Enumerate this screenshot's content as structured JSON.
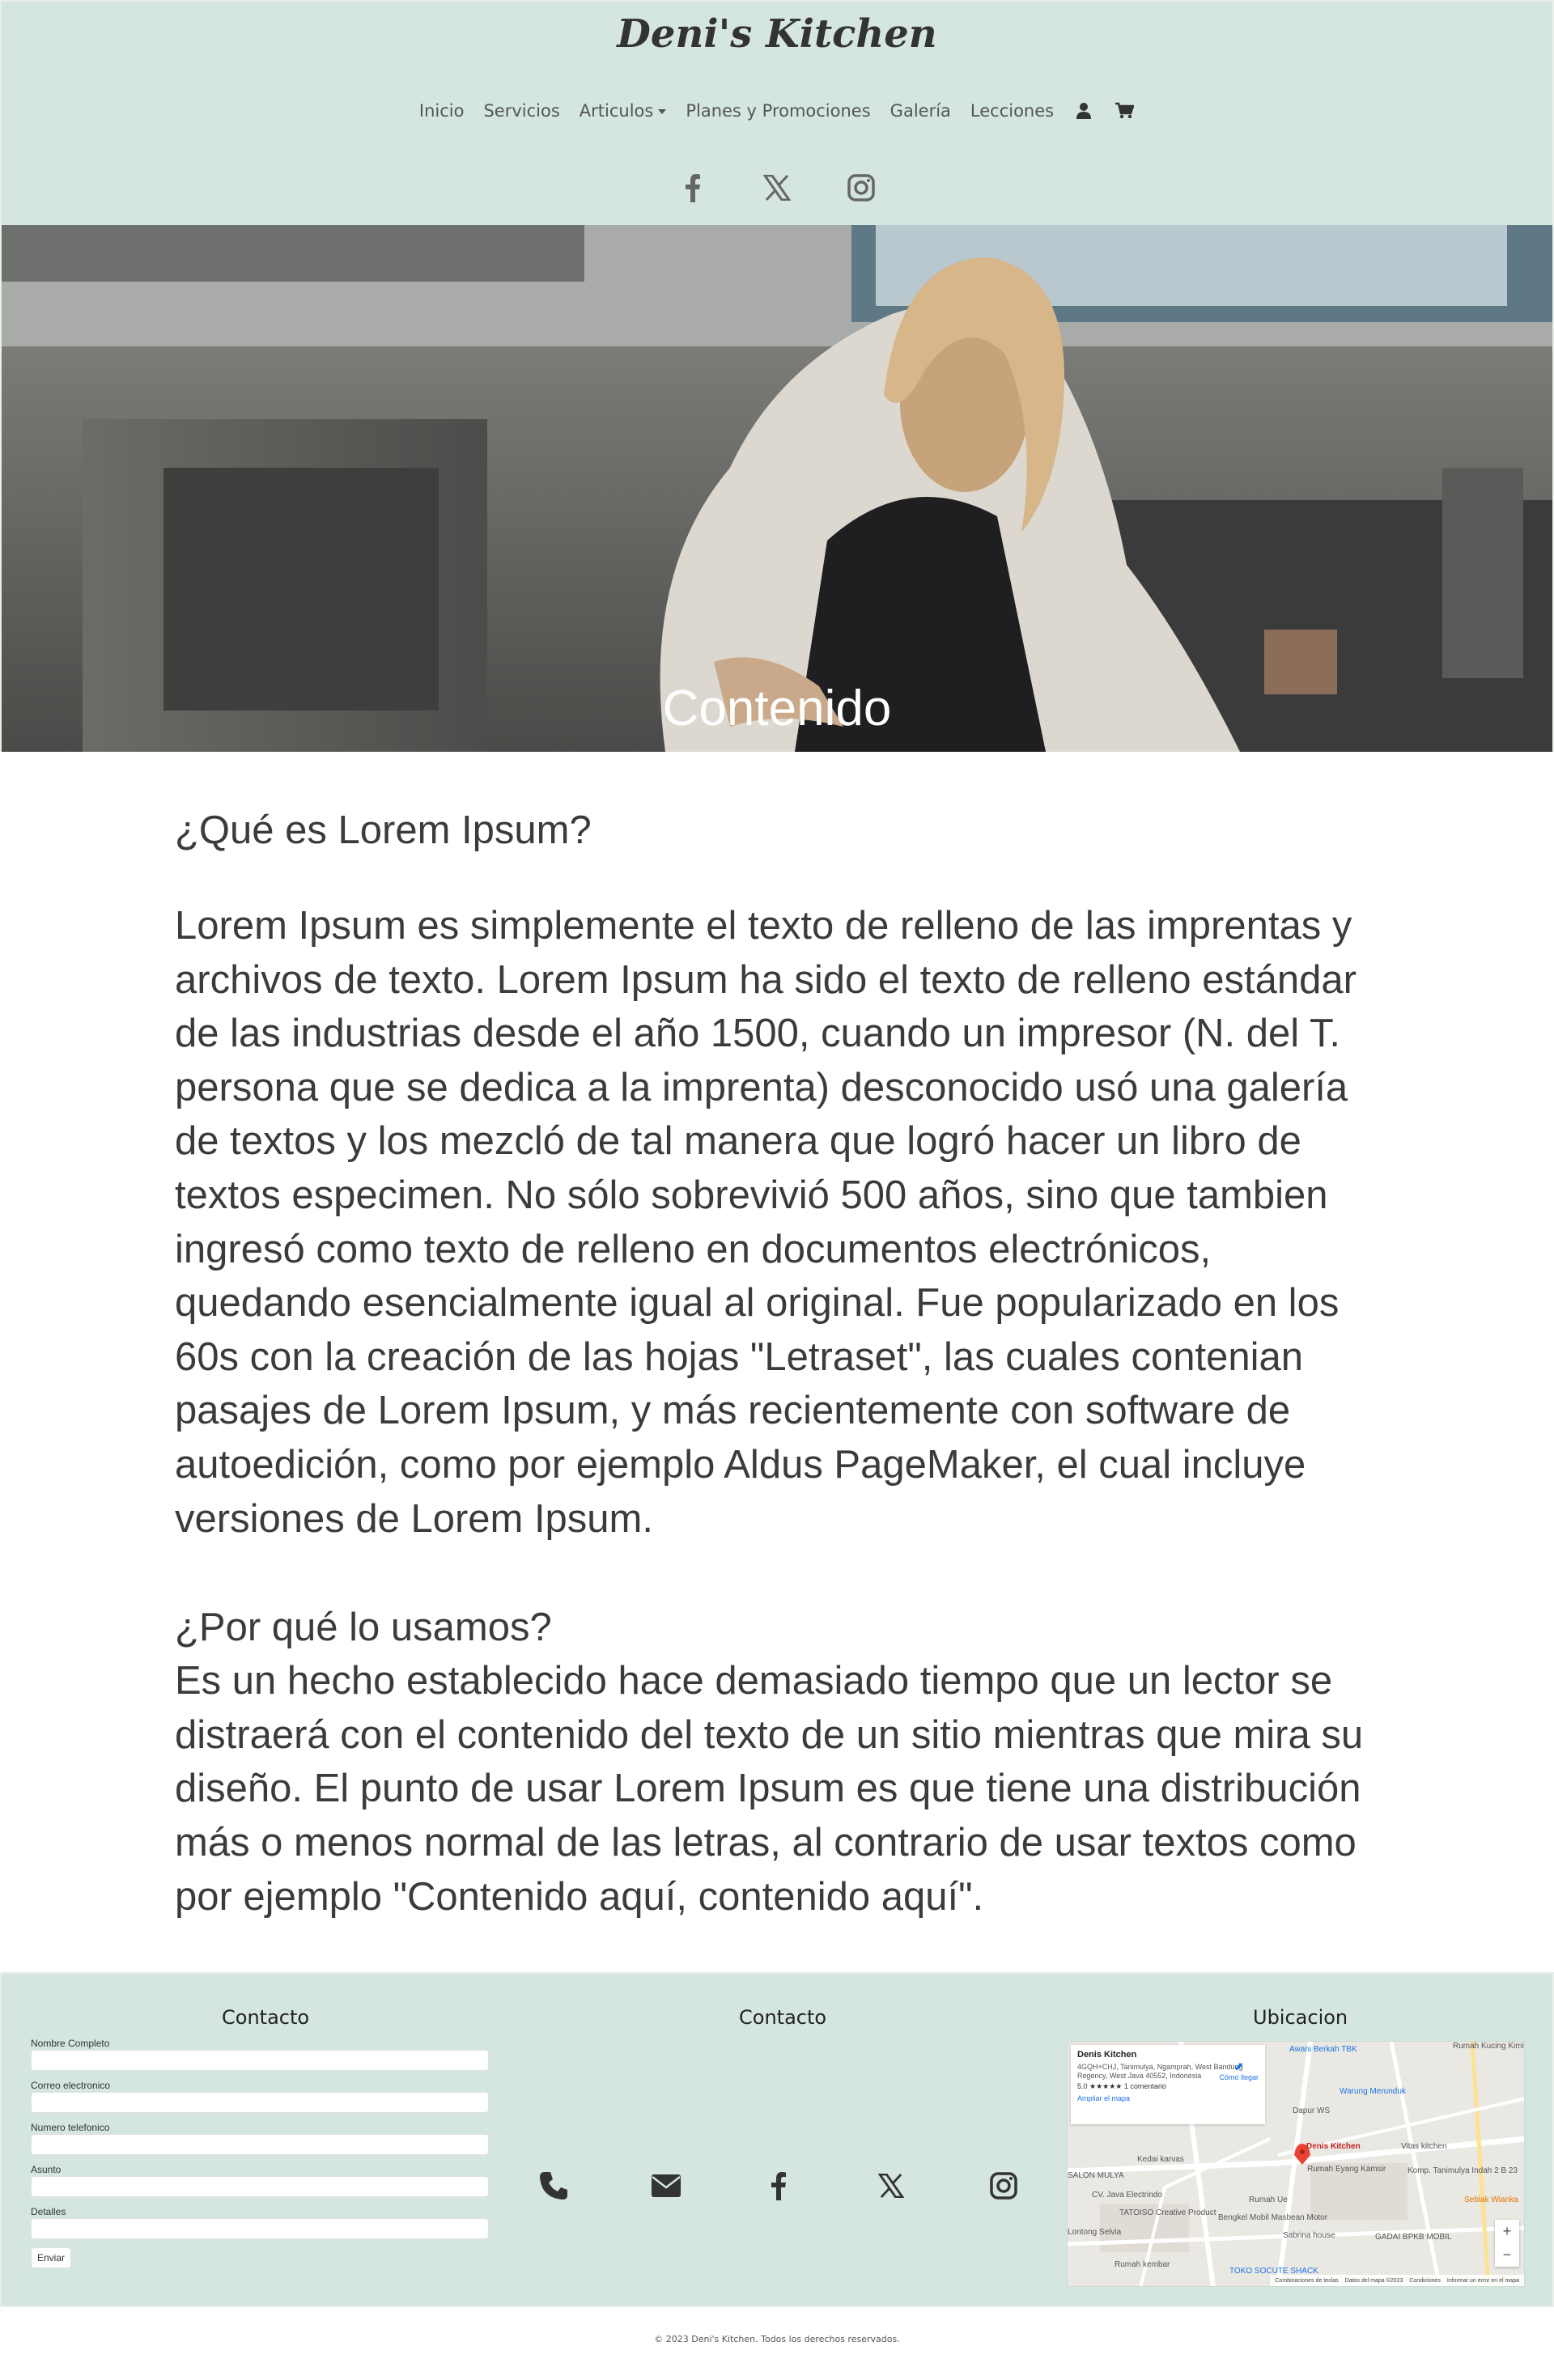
{
  "header": {
    "brand": "Deni's Kitchen",
    "nav": [
      "Inicio",
      "Servicios",
      "Articulos",
      "Planes y Promociones",
      "Galería",
      "Lecciones"
    ],
    "nav_icons": [
      "user-icon",
      "cart-icon"
    ],
    "social": [
      "facebook-icon",
      "x-icon",
      "instagram-icon"
    ]
  },
  "hero": {
    "title": "Contenido"
  },
  "content": {
    "q1": "¿Qué es Lorem Ipsum?",
    "p1": "Lorem Ipsum es simplemente el texto de relleno de las imprentas y archivos de texto. Lorem Ipsum ha sido el texto de relleno estándar de las industrias desde el año 1500, cuando un impresor (N. del T. persona que se dedica a la imprenta) desconocido usó una galería de textos y los mezcló de tal manera que logró hacer un libro de textos especimen. No sólo sobrevivió 500 años, sino que tambien ingresó como texto de relleno en documentos electrónicos, quedando esencialmente igual al original. Fue popularizado en los 60s con la creación de las hojas \"Letraset\", las cuales contenian pasajes de Lorem Ipsum, y más recientemente con software de autoedición, como por ejemplo Aldus PageMaker, el cual incluye versiones de Lorem Ipsum.",
    "q2": "¿Por qué lo usamos?",
    "p2": "Es un hecho establecido hace demasiado tiempo que un lector se distraerá con el contenido del texto de un sitio mientras que mira su diseño. El punto de usar Lorem Ipsum es que tiene una distribución más o menos normal de las letras, al contrario de usar textos como por ejemplo \"Contenido aquí, contenido aquí\"."
  },
  "footer": {
    "col1_title": "Contacto",
    "col2_title": "Contacto",
    "col3_title": "Ubicacion",
    "form": {
      "labels": [
        "Nombre Completo",
        "Correo electronico",
        "Numero telefonico",
        "Asunto",
        "Detalles"
      ],
      "submit": "Enviar"
    },
    "icons": [
      "phone-icon",
      "envelope-icon",
      "facebook-icon",
      "x-icon",
      "instagram-icon"
    ],
    "map": {
      "name": "Denis Kitchen",
      "address": "4GQH+CHJ, Tanimulya, Ngamprah, West Bandung Regency, West Java 40552, Indonesia",
      "rating": "5.0 ★★★★★   1 comentario",
      "link": "Ampliar el mapa",
      "directions": "Cómo llegar",
      "pin_label": "Denis Kitchen",
      "places": [
        "Awani Berkah TBK",
        "Rumah Kucing Kimi",
        "Warung Merunduk",
        "Dapur WS",
        "Kedai karvas",
        "Vitas kitchen",
        "Rumah Eyang Kamsir",
        "CV. Java Electrindo",
        "Rumah Ue",
        "TATOISO Creative Product",
        "Bengkel Mobil Masbean Motor",
        "Sabrina house",
        "GADAI BPKB MOBIL",
        "Seblak Wianka",
        "Lontong Selvia",
        "Rumah kembar",
        "TOKO SOCUTE SHACK",
        "Komp. Tanimulya Indah 2 B 23",
        "SALON MULYA"
      ],
      "footer_items": [
        "Combinaciones de teclas",
        "Datos del mapa ©2023",
        "Condiciones",
        "Informar un error en el mapa"
      ]
    }
  },
  "copyright": "© 2023 Deni's Kitchen. Todos los derechos reservados."
}
